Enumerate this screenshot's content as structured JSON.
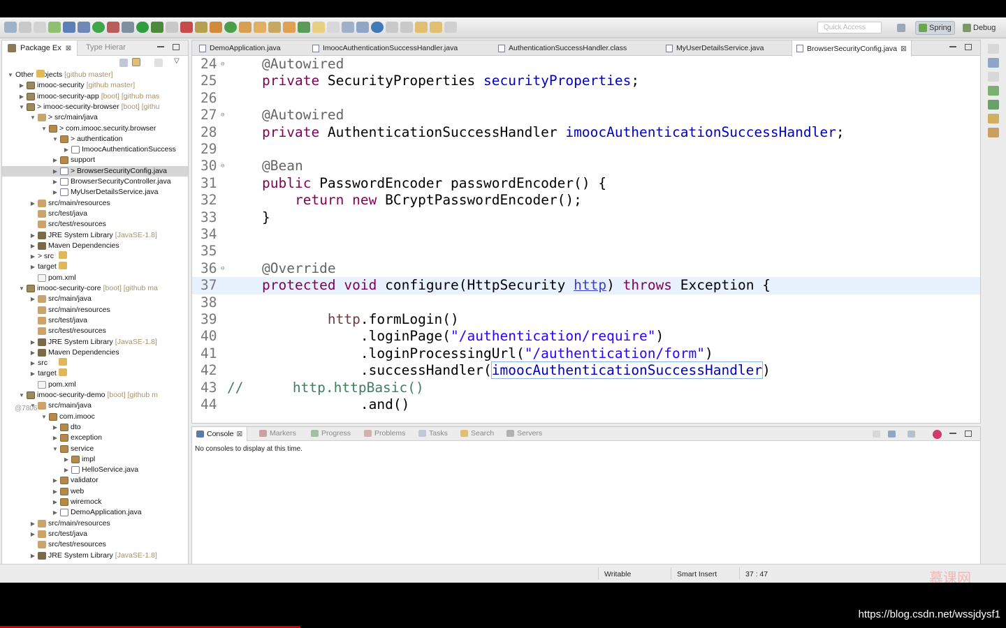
{
  "toolbar": {
    "quick_access_placeholder": "Quick Access",
    "perspective_spring": "Spring",
    "perspective_debug": "Debug"
  },
  "left_panel": {
    "tab_package": "Package Ex",
    "tab_type": "Type Hierar",
    "tree": [
      {
        "label": "Other Projects",
        "extra": "[github master]"
      },
      {
        "label": "imooc-security",
        "extra": "[github master]"
      },
      {
        "label": "imooc-security-app",
        "extra": "[boot] [github mas"
      },
      {
        "label": "> imooc-security-browser",
        "extra": "[boot] [githu"
      },
      {
        "label": "> src/main/java",
        "extra": ""
      },
      {
        "label": "> com.imooc.security.browser",
        "extra": ""
      },
      {
        "label": "> authentication",
        "extra": ""
      },
      {
        "label": "ImoocAuthenticationSuccess",
        "extra": ""
      },
      {
        "label": "support",
        "extra": ""
      },
      {
        "label": "> BrowserSecurityConfig.java",
        "extra": ""
      },
      {
        "label": "BrowserSecurityController.java",
        "extra": ""
      },
      {
        "label": "MyUserDetailsService.java",
        "extra": ""
      },
      {
        "label": "src/main/resources",
        "extra": ""
      },
      {
        "label": "src/test/java",
        "extra": ""
      },
      {
        "label": "src/test/resources",
        "extra": ""
      },
      {
        "label": "JRE System Library",
        "extra": "[JavaSE-1.8]"
      },
      {
        "label": "Maven Dependencies",
        "extra": ""
      },
      {
        "label": "> src",
        "extra": ""
      },
      {
        "label": "target",
        "extra": ""
      },
      {
        "label": "pom.xml",
        "extra": ""
      },
      {
        "label": "imooc-security-core",
        "extra": "[boot] [github ma"
      },
      {
        "label": "src/main/java",
        "extra": ""
      },
      {
        "label": "src/main/resources",
        "extra": ""
      },
      {
        "label": "src/test/java",
        "extra": ""
      },
      {
        "label": "src/test/resources",
        "extra": ""
      },
      {
        "label": "JRE System Library",
        "extra": "[JavaSE-1.8]"
      },
      {
        "label": "Maven Dependencies",
        "extra": ""
      },
      {
        "label": "src",
        "extra": ""
      },
      {
        "label": "target",
        "extra": ""
      },
      {
        "label": "pom.xml",
        "extra": ""
      },
      {
        "label": "imooc-security-demo",
        "extra": "[boot] [github m"
      },
      {
        "label": "src/main/java",
        "extra": ""
      },
      {
        "label": "com.imooc",
        "extra": ""
      },
      {
        "label": "dto",
        "extra": ""
      },
      {
        "label": "exception",
        "extra": ""
      },
      {
        "label": "service",
        "extra": ""
      },
      {
        "label": "impl",
        "extra": ""
      },
      {
        "label": "HelloService.java",
        "extra": ""
      },
      {
        "label": "validator",
        "extra": ""
      },
      {
        "label": "web",
        "extra": ""
      },
      {
        "label": "wiremock",
        "extra": ""
      },
      {
        "label": "DemoApplication.java",
        "extra": ""
      },
      {
        "label": "src/main/resources",
        "extra": ""
      },
      {
        "label": "src/test/java",
        "extra": ""
      },
      {
        "label": "src/test/resources",
        "extra": ""
      },
      {
        "label": "JRE System Library",
        "extra": "[JavaSE-1.8]"
      }
    ],
    "overlay_tag": "@7806"
  },
  "editor": {
    "tabs": [
      "DemoApplication.java",
      "ImoocAuthenticationSuccessHandler.java",
      "AuthenticationSuccessHandler.class",
      "MyUserDetailsService.java",
      "BrowserSecurityConfig.java"
    ],
    "line_numbers": [
      "24",
      "25",
      "26",
      "27",
      "28",
      "29",
      "30",
      "31",
      "32",
      "33",
      "34",
      "35",
      "36",
      "37",
      "38",
      "39",
      "40",
      "41",
      "42",
      "43",
      "44"
    ]
  },
  "console": {
    "tabs": [
      "Console",
      "Markers",
      "Progress",
      "Problems",
      "Tasks",
      "Search",
      "Servers"
    ],
    "message": "No consoles to display at this time."
  },
  "statusbar": {
    "writable": "Writable",
    "insert_mode": "Smart Insert",
    "position": "37 : 47"
  },
  "watermark": "慕课网",
  "footer_url": "https://blog.csdn.net/wssjdysf1"
}
